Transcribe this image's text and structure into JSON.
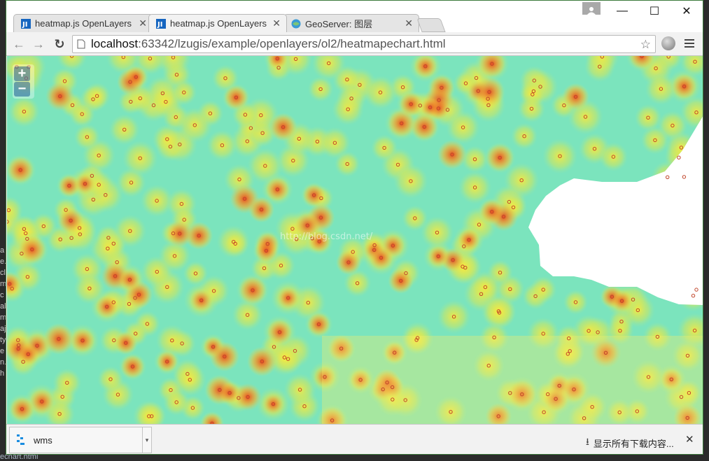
{
  "browser": {
    "tabs": [
      {
        "title": "heatmap.js OpenLayers",
        "icon": "webstorm-icon",
        "active": false
      },
      {
        "title": "heatmap.js OpenLayers",
        "icon": "webstorm-icon",
        "active": true
      },
      {
        "title": "GeoServer: 图层",
        "icon": "geoserver-icon",
        "active": false
      }
    ],
    "url": {
      "host": "localhost",
      "path": ":63342/lzugis/example/openlayers/ol2/heatmapechart.html"
    },
    "window_controls": {
      "minimize": "—",
      "maximize": "☐",
      "close": "✕"
    }
  },
  "map": {
    "zoom_in": "+",
    "zoom_out": "−",
    "watermark": "http://blog.csdn.net/",
    "colors": {
      "low": "#7be4bd",
      "mid": "#d6ea62",
      "high": "#f5ef3c",
      "peak": "#e3311d",
      "water": "#ffffff"
    }
  },
  "downloads": {
    "item_name": "wms",
    "show_all": "显示所有下载内容...",
    "close": "✕"
  },
  "ide": {
    "left_letters": [
      "a",
      "e.",
      "cl",
      "m",
      "c",
      "al",
      "m",
      "aj",
      "ty",
      "e",
      "n.",
      "h"
    ],
    "bottom_file": "echart.html"
  }
}
